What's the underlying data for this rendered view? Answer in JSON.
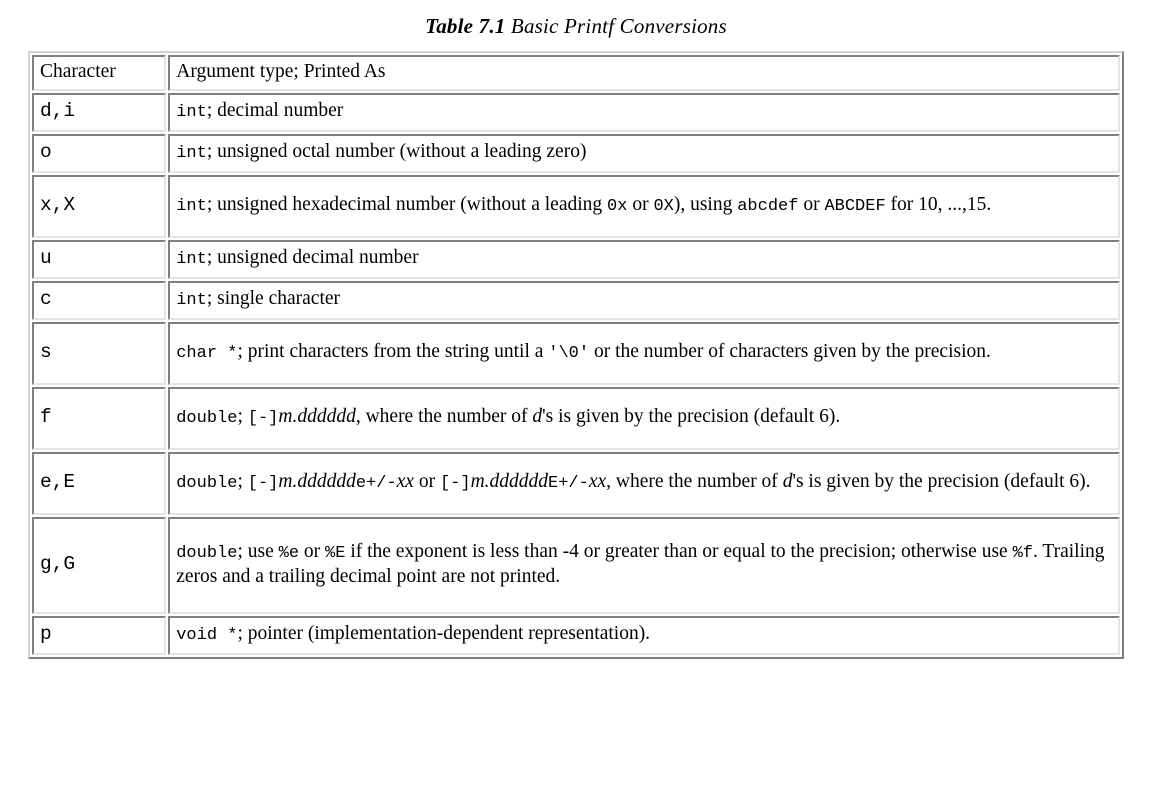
{
  "caption": {
    "number": "Table 7.1",
    "text": "Basic Printf Conversions"
  },
  "table": {
    "headers": {
      "character": "Character",
      "description": "Argument type; Printed As"
    },
    "rows": [
      {
        "character": "d,i",
        "height_class": "r-short",
        "description_plain": "int; decimal number",
        "parts": [
          {
            "style": "mono",
            "text": "int"
          },
          {
            "style": "serif",
            "text": "; decimal number"
          }
        ]
      },
      {
        "character": "o",
        "height_class": "r-short",
        "description_plain": "int; unsigned octal number (without a leading zero)",
        "parts": [
          {
            "style": "mono",
            "text": "int"
          },
          {
            "style": "serif",
            "text": "; unsigned octal number (without a leading zero)"
          }
        ]
      },
      {
        "character": "x,X",
        "height_class": "r-med",
        "description_plain": "int; unsigned hexadecimal number (without a leading 0x or 0X), using abcdef or ABCDEF for 10, ...,15.",
        "parts": [
          {
            "style": "mono",
            "text": "int"
          },
          {
            "style": "serif",
            "text": "; unsigned hexadecimal number (without a leading "
          },
          {
            "style": "mono",
            "text": "0x"
          },
          {
            "style": "serif",
            "text": " or "
          },
          {
            "style": "mono",
            "text": "0X"
          },
          {
            "style": "serif",
            "text": "), using "
          },
          {
            "style": "mono",
            "text": "abcdef"
          },
          {
            "style": "serif",
            "text": " or "
          },
          {
            "style": "mono",
            "text": "ABCDEF"
          },
          {
            "style": "serif",
            "text": " for 10, ...,15."
          }
        ]
      },
      {
        "character": "u",
        "height_class": "r-short",
        "description_plain": "int; unsigned decimal number",
        "parts": [
          {
            "style": "mono",
            "text": "int"
          },
          {
            "style": "serif",
            "text": "; unsigned decimal number"
          }
        ]
      },
      {
        "character": "c",
        "height_class": "r-short",
        "description_plain": "int; single character",
        "parts": [
          {
            "style": "mono",
            "text": "int"
          },
          {
            "style": "serif",
            "text": "; single character"
          }
        ]
      },
      {
        "character": "s",
        "height_class": "r-med",
        "description_plain": "char *; print characters from the string until a '\\0' or the number of characters given by the precision.",
        "parts": [
          {
            "style": "mono",
            "text": "char *"
          },
          {
            "style": "serif",
            "text": "; print characters from the string until a "
          },
          {
            "style": "mono",
            "text": "'\\0'"
          },
          {
            "style": "serif",
            "text": " or the number of characters given by the precision."
          }
        ]
      },
      {
        "character": "f",
        "height_class": "r-med",
        "description_plain": "double; [-]m.dddddd, where the number of d's is given by the precision (default 6).",
        "parts": [
          {
            "style": "mono",
            "text": "double"
          },
          {
            "style": "serif",
            "text": "; "
          },
          {
            "style": "mono",
            "text": "[-]"
          },
          {
            "style": "italic",
            "text": "m.dddddd"
          },
          {
            "style": "serif",
            "text": ", where the number of "
          },
          {
            "style": "italic",
            "text": "d"
          },
          {
            "style": "serif",
            "text": "'s is given by the precision (default 6)."
          }
        ]
      },
      {
        "character": "e,E",
        "height_class": "r-med",
        "description_plain": "double; [-]m.ddddddе+/-xx or [-]m.ddddddE+/-xx, where the number of d's is given by the precision (default 6).",
        "parts": [
          {
            "style": "mono",
            "text": "double"
          },
          {
            "style": "serif",
            "text": "; "
          },
          {
            "style": "mono",
            "text": "[-]"
          },
          {
            "style": "italic",
            "text": "m.dddddd"
          },
          {
            "style": "mono",
            "text": "e+/-"
          },
          {
            "style": "italic",
            "text": "xx"
          },
          {
            "style": "serif",
            "text": " or "
          },
          {
            "style": "mono",
            "text": "[-]"
          },
          {
            "style": "italic",
            "text": "m.dddddd"
          },
          {
            "style": "mono",
            "text": "E+/-"
          },
          {
            "style": "italic",
            "text": "xx"
          },
          {
            "style": "serif",
            "text": ", where the number of "
          },
          {
            "style": "italic",
            "text": "d"
          },
          {
            "style": "serif",
            "text": "'s is given by the precision (default 6)."
          }
        ]
      },
      {
        "character": "g,G",
        "height_class": "r-xtall",
        "description_plain": "double; use %e or %E if the exponent is less than -4 or greater than or equal to the precision; otherwise use %f. Trailing zeros and a trailing decimal point are not printed.",
        "parts": [
          {
            "style": "mono",
            "text": "double"
          },
          {
            "style": "serif",
            "text": "; use "
          },
          {
            "style": "mono",
            "text": "%e"
          },
          {
            "style": "serif",
            "text": " or "
          },
          {
            "style": "mono",
            "text": "%E"
          },
          {
            "style": "serif",
            "text": " if the exponent is less than -4 or greater than or equal to the precision; otherwise use "
          },
          {
            "style": "mono",
            "text": "%f"
          },
          {
            "style": "serif",
            "text": ". Trailing zeros and a trailing decimal point are not printed."
          }
        ]
      },
      {
        "character": "p",
        "height_class": "r-short",
        "description_plain": "void *; pointer (implementation-dependent representation).",
        "parts": [
          {
            "style": "mono",
            "text": "void *"
          },
          {
            "style": "serif",
            "text": "; pointer (implementation-dependent representation)."
          }
        ]
      }
    ]
  },
  "colors": {
    "page_background": "#ffffff",
    "text": "#000000",
    "border_dark": "#808080",
    "border_light": "#e8e4dc"
  }
}
